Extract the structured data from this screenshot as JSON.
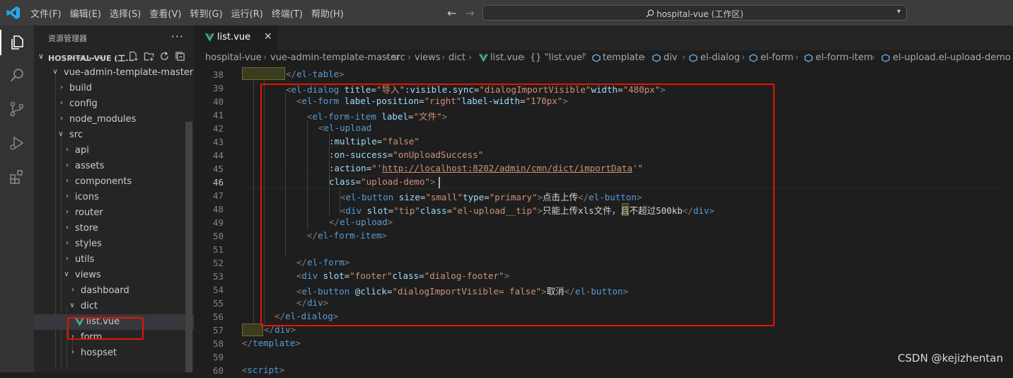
{
  "titlebar": {
    "menu": [
      "文件(F)",
      "编辑(E)",
      "选择(S)",
      "查看(V)",
      "转到(G)",
      "运行(R)",
      "终端(T)",
      "帮助(H)"
    ],
    "search_text": "hospital-vue (工作区)"
  },
  "sidebar": {
    "title": "资源管理器",
    "more": "···",
    "section": "HOSPITAL-VUE (工...",
    "items": [
      {
        "label": "npm_pro",
        "depth": 1,
        "type": "partial"
      },
      {
        "label": "vue-admin-template-master",
        "depth": 1,
        "type": "folder-open"
      },
      {
        "label": "build",
        "depth": 2,
        "type": "folder"
      },
      {
        "label": "config",
        "depth": 2,
        "type": "folder"
      },
      {
        "label": "node_modules",
        "depth": 2,
        "type": "folder"
      },
      {
        "label": "src",
        "depth": 2,
        "type": "folder-open"
      },
      {
        "label": "api",
        "depth": 3,
        "type": "folder"
      },
      {
        "label": "assets",
        "depth": 3,
        "type": "folder"
      },
      {
        "label": "components",
        "depth": 3,
        "type": "folder"
      },
      {
        "label": "icons",
        "depth": 3,
        "type": "folder"
      },
      {
        "label": "router",
        "depth": 3,
        "type": "folder"
      },
      {
        "label": "store",
        "depth": 3,
        "type": "folder"
      },
      {
        "label": "styles",
        "depth": 3,
        "type": "folder"
      },
      {
        "label": "utils",
        "depth": 3,
        "type": "folder"
      },
      {
        "label": "views",
        "depth": 3,
        "type": "folder-open"
      },
      {
        "label": "dashboard",
        "depth": 4,
        "type": "folder"
      },
      {
        "label": "dict",
        "depth": 4,
        "type": "folder-open"
      },
      {
        "label": "list.vue",
        "depth": 5,
        "type": "file",
        "selected": true
      },
      {
        "label": "form",
        "depth": 4,
        "type": "folder"
      },
      {
        "label": "hospset",
        "depth": 4,
        "type": "folder"
      }
    ]
  },
  "editor": {
    "tab_label": "list.vue",
    "close_glyph": "✕",
    "breadcrumb": [
      "hospital-vue",
      "vue-admin-template-master",
      "src",
      "views",
      "dict",
      "list.vue",
      "{} \"list.vue\"",
      "template",
      "div",
      "el-dialog",
      "el-form",
      "el-form-item",
      "el-upload.el-upload-demo"
    ],
    "line_numbers": [
      "38",
      "39",
      "40",
      "41",
      "42",
      "43",
      "44",
      "45",
      "46",
      "47",
      "48",
      "49",
      "50",
      "51",
      "52",
      "53",
      "54",
      "55",
      "56",
      "57",
      "58",
      "59",
      "60"
    ],
    "active_line": "46"
  },
  "watermark": "CSDN @kejizhentan",
  "colors": {
    "accent_red": "#e51400",
    "vue_green": "#41b883",
    "tag_blue": "#569cd6",
    "attr": "#9cdcfe",
    "string": "#ce9178"
  }
}
